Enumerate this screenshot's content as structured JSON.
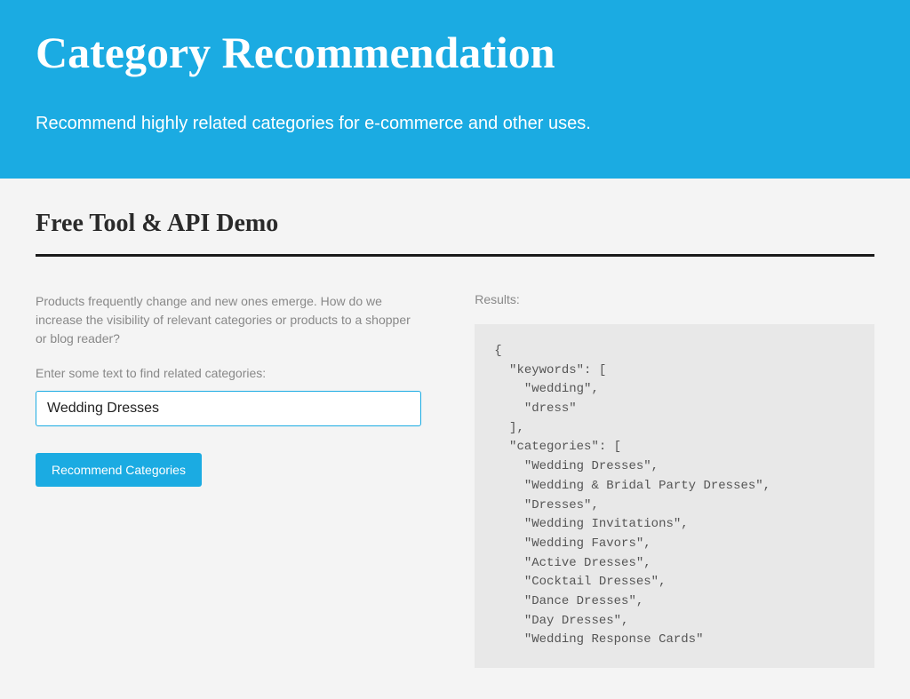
{
  "hero": {
    "title": "Category Recommendation",
    "subtitle": "Recommend highly related categories for e-commerce and other uses."
  },
  "demo": {
    "section_title": "Free Tool & API Demo",
    "intro": "Products frequently change and new ones emerge. How do we increase the visibility of relevant categories or products to a shopper or blog reader?",
    "input_label": "Enter some text to find related categories:",
    "input_value": "Wedding Dresses",
    "button_label": "Recommend Categories",
    "results_label": "Results:"
  },
  "results": {
    "keywords": [
      "wedding",
      "dress"
    ],
    "categories": [
      "Wedding Dresses",
      "Wedding & Bridal Party Dresses",
      "Dresses",
      "Wedding Invitations",
      "Wedding Favors",
      "Active Dresses",
      "Cocktail Dresses",
      "Dance Dresses",
      "Day Dresses",
      "Wedding Response Cards"
    ]
  }
}
